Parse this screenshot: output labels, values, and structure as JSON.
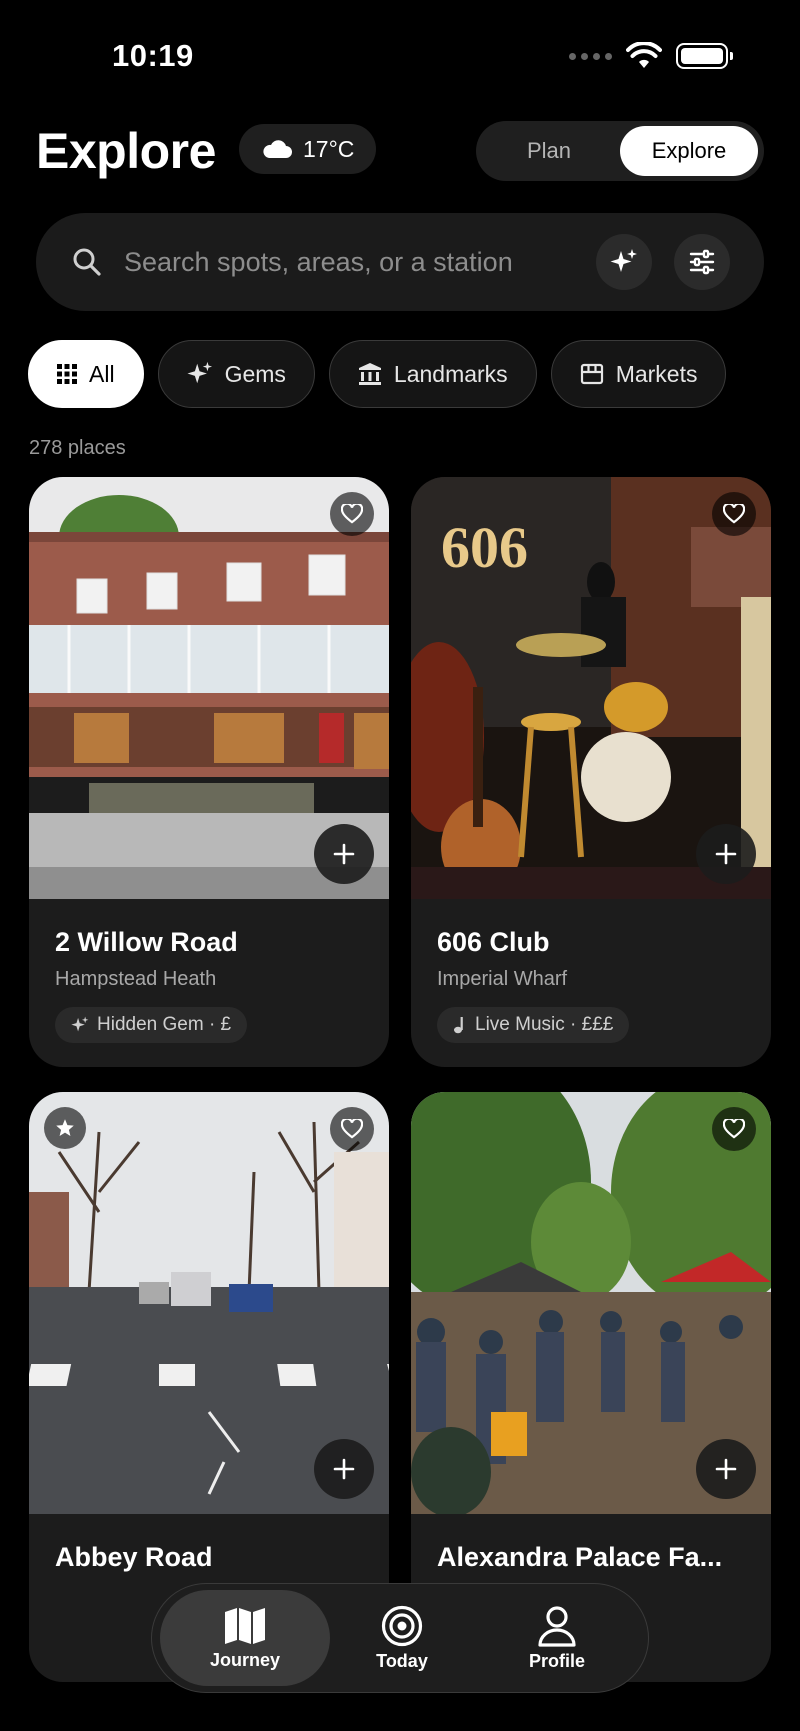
{
  "status": {
    "time": "10:19"
  },
  "header": {
    "title": "Explore",
    "weather": "17°C"
  },
  "mode_toggle": {
    "plan_label": "Plan",
    "explore_label": "Explore",
    "active": "Explore"
  },
  "search": {
    "placeholder": "Search spots, areas, or a station"
  },
  "categories": [
    {
      "label": "All",
      "icon": "grid-icon",
      "active": true
    },
    {
      "label": "Gems",
      "icon": "sparkle-icon",
      "active": false
    },
    {
      "label": "Landmarks",
      "icon": "landmark-icon",
      "active": false
    },
    {
      "label": "Markets",
      "icon": "store-icon",
      "active": false
    }
  ],
  "results": {
    "count_label": "278 places"
  },
  "places": [
    {
      "name": "2 Willow Road",
      "area": "Hampstead Heath",
      "tag": "Hidden Gem · £",
      "tag_icon": "sparkle-icon"
    },
    {
      "name": "606 Club",
      "area": "Imperial Wharf",
      "tag": "Live Music · £££",
      "tag_icon": "music-note-icon",
      "sign_text": "606"
    },
    {
      "name": "Abbey Road",
      "starred": true
    },
    {
      "name": "Alexandra Palace Fa..."
    }
  ],
  "tabbar": [
    {
      "label": "Journey",
      "icon": "map-icon",
      "active": true
    },
    {
      "label": "Today",
      "icon": "target-icon",
      "active": false
    },
    {
      "label": "Profile",
      "icon": "person-icon",
      "active": false
    }
  ],
  "colors": {
    "background": "#000000",
    "surface": "#1c1c1c",
    "accent": "#ffffff"
  }
}
